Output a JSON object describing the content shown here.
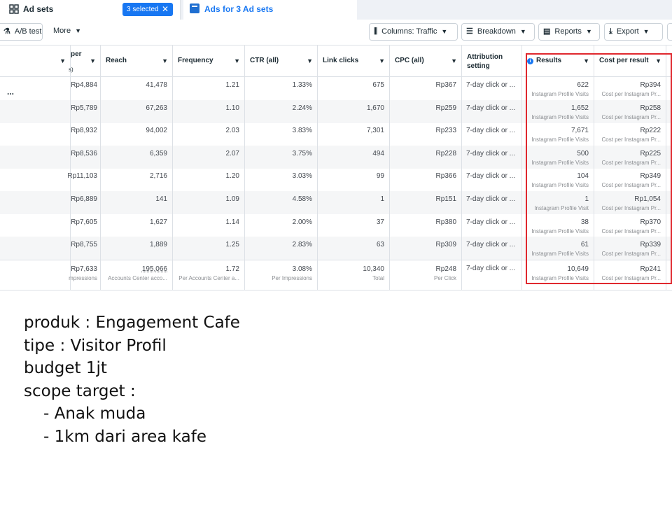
{
  "tabs": {
    "adsets_label": "Ad sets",
    "selected_label": "3 selected",
    "close_glyph": "✕",
    "ads_label": "Ads for 3 Ad sets"
  },
  "toolbar": {
    "ab_test_label": "A/B test",
    "more_label": "More",
    "columns_label": "Columns: Traffic",
    "breakdown_label": "Breakdown",
    "reports_label": "Reports",
    "export_label": "Export"
  },
  "headers": {
    "col0": "",
    "cost_per": "per",
    "cost_per_sub": "s)",
    "reach": "Reach",
    "frequency": "Frequency",
    "ctr": "CTR (all)",
    "link_clicks": "Link clicks",
    "cpc": "CPC (all)",
    "attribution_1": "Attribution",
    "attribution_2": "setting",
    "results": "Results",
    "cost_per_result": "Cost per result"
  },
  "row_actions_glyph": "...",
  "rows": [
    {
      "cpi": "Rp4,884",
      "reach": "41,478",
      "freq": "1.21",
      "ctr": "1.33%",
      "clicks": "675",
      "cpc": "Rp367",
      "attr": "7-day click or ...",
      "results": "622",
      "results_sub": "Instagram Profile Visits",
      "cpr": "Rp394",
      "cpr_sub": "Cost per Instagram Pr..."
    },
    {
      "cpi": "Rp5,789",
      "reach": "67,263",
      "freq": "1.10",
      "ctr": "2.24%",
      "clicks": "1,670",
      "cpc": "Rp259",
      "attr": "7-day click or ...",
      "results": "1,652",
      "results_sub": "Instagram Profile Visits",
      "cpr": "Rp258",
      "cpr_sub": "Cost per Instagram Pr..."
    },
    {
      "cpi": "Rp8,932",
      "reach": "94,002",
      "freq": "2.03",
      "ctr": "3.83%",
      "clicks": "7,301",
      "cpc": "Rp233",
      "attr": "7-day click or ...",
      "results": "7,671",
      "results_sub": "Instagram Profile Visits",
      "cpr": "Rp222",
      "cpr_sub": "Cost per Instagram Pr..."
    },
    {
      "cpi": "Rp8,536",
      "reach": "6,359",
      "freq": "2.07",
      "ctr": "3.75%",
      "clicks": "494",
      "cpc": "Rp228",
      "attr": "7-day click or ...",
      "results": "500",
      "results_sub": "Instagram Profile Visits",
      "cpr": "Rp225",
      "cpr_sub": "Cost per Instagram Pr..."
    },
    {
      "cpi": "Rp11,103",
      "reach": "2,716",
      "freq": "1.20",
      "ctr": "3.03%",
      "clicks": "99",
      "cpc": "Rp366",
      "attr": "7-day click or ...",
      "results": "104",
      "results_sub": "Instagram Profile Visits",
      "cpr": "Rp349",
      "cpr_sub": "Cost per Instagram Pr..."
    },
    {
      "cpi": "Rp6,889",
      "reach": "141",
      "freq": "1.09",
      "ctr": "4.58%",
      "clicks": "1",
      "cpc": "Rp151",
      "attr": "7-day click or ...",
      "results": "1",
      "results_sub": "Instagram Profile Visit",
      "cpr": "Rp1,054",
      "cpr_sub": "Cost per Instagram Pr..."
    },
    {
      "cpi": "Rp7,605",
      "reach": "1,627",
      "freq": "1.14",
      "ctr": "2.00%",
      "clicks": "37",
      "cpc": "Rp380",
      "attr": "7-day click or ...",
      "results": "38",
      "results_sub": "Instagram Profile Visits",
      "cpr": "Rp370",
      "cpr_sub": "Cost per Instagram Pr..."
    },
    {
      "cpi": "Rp8,755",
      "reach": "1,889",
      "freq": "1.25",
      "ctr": "2.83%",
      "clicks": "63",
      "cpc": "Rp309",
      "attr": "7-day click or ...",
      "results": "61",
      "results_sub": "Instagram Profile Visits",
      "cpr": "Rp339",
      "cpr_sub": "Cost per Instagram Pr..."
    }
  ],
  "totals": {
    "cpi": "Rp7,633",
    "cpi_sub": "mpressions",
    "reach": "195,066",
    "reach_sub": "Accounts Center acco...",
    "freq": "1.72",
    "freq_sub": "Per Accounts Center a...",
    "ctr": "3.08%",
    "ctr_sub": "Per Impressions",
    "clicks": "10,340",
    "clicks_sub": "Total",
    "cpc": "Rp248",
    "cpc_sub": "Per Click",
    "attr": "7-day click or ...",
    "results": "10,649",
    "results_sub": "Instagram Profile Visits",
    "cpr": "Rp241",
    "cpr_sub": "Cost per Instagram Pr..."
  },
  "highlight_color": "#e0282e",
  "accent_color": "#1877f2",
  "notes": {
    "line1": "produk : Engagement Cafe",
    "line2": "tipe : Visitor Profil",
    "line3": "budget 1jt",
    "line4": "scope target :",
    "line5": "- Anak muda",
    "line6": "- 1km dari area kafe"
  }
}
